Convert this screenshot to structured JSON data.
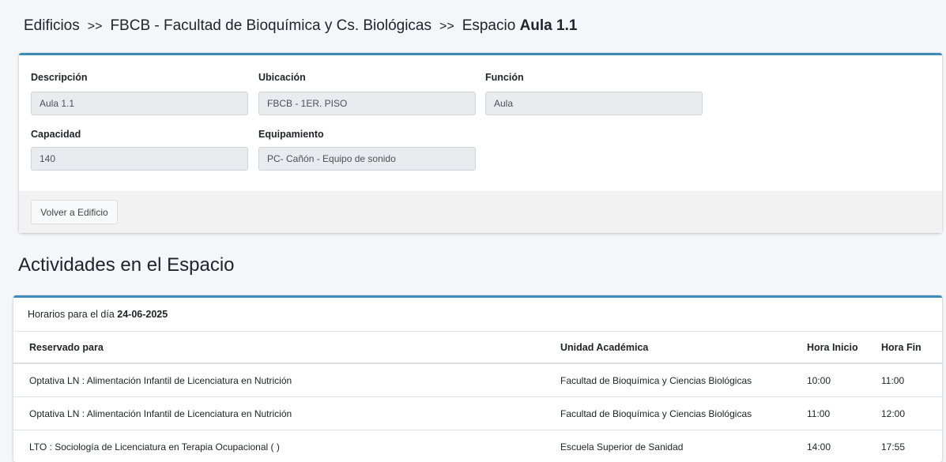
{
  "breadcrumb": {
    "edificios": "Edificios",
    "sep1": ">>",
    "edificio": "FBCB - Facultad de Bioquímica y Cs. Biológicas",
    "sep2": ">>",
    "espacio_prefix": "Espacio",
    "espacio_name": "Aula 1.1"
  },
  "details": {
    "descripcion_label": "Descripción",
    "descripcion_value": "Aula 1.1",
    "ubicacion_label": "Ubicación",
    "ubicacion_value": "FBCB - 1ER. PISO",
    "funcion_label": "Función",
    "funcion_value": "Aula",
    "capacidad_label": "Capacidad",
    "capacidad_value": "140",
    "equipamiento_label": "Equipamiento",
    "equipamiento_value": "PC- Cañón - Equipo de sonido",
    "back_button": "Volver a Edificio"
  },
  "activities": {
    "title": "Actividades en el Espacio",
    "horarios_prefix": "Horarios para el día",
    "date": "24-06-2025",
    "columns": [
      "Reservado para",
      "Unidad Académica",
      "Hora Inicio",
      "Hora Fin"
    ],
    "rows": [
      [
        "Optativa LN : Alimentación Infantil de Licenciatura en Nutrición",
        "Facultad de Bioquímica y Ciencias Biológicas",
        "10:00",
        "11:00"
      ],
      [
        "Optativa LN : Alimentación Infantil de Licenciatura en Nutrición",
        "Facultad de Bioquímica y Ciencias Biológicas",
        "11:00",
        "12:00"
      ],
      [
        "LTO : Sociología de Licenciatura en Terapia Ocupacional ( )",
        "Escuela Superior de Sanidad",
        "14:00",
        "17:55"
      ]
    ]
  },
  "colors": {
    "accent": "#3c8dbc",
    "background": "#f4f6f9",
    "input_bg": "#e9ecef"
  }
}
